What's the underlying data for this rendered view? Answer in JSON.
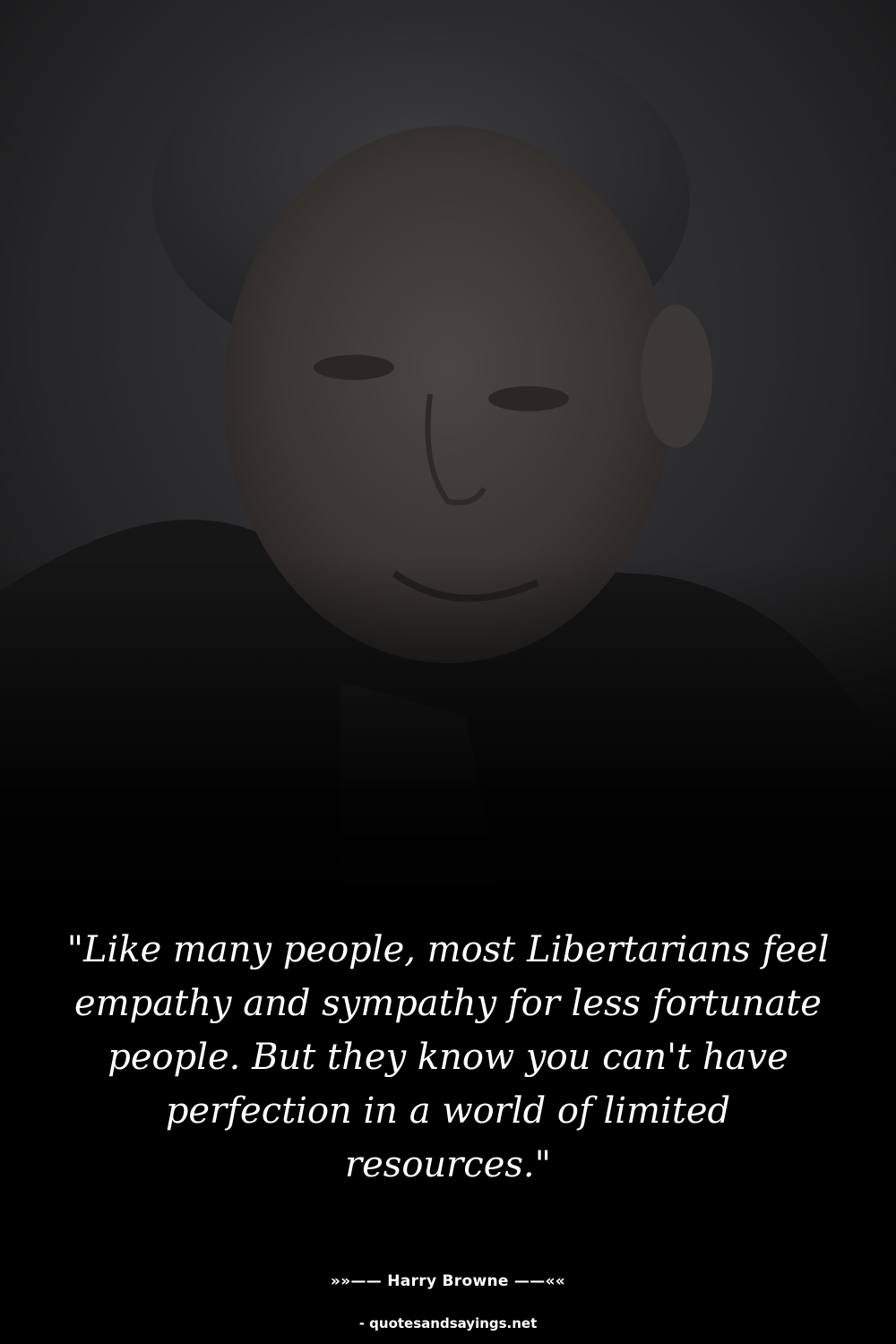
{
  "quote": {
    "text": "\"Like many people, most Libertarians feel empathy and sympathy for less fortunate people. But they know you can't have perfection in a world of limited resources.\""
  },
  "attribution": {
    "author_line": "»»—— Harry Browne ——««"
  },
  "footer": {
    "source": "- quotesandsayings.net"
  },
  "colors": {
    "background": "#000000",
    "text": "#ffffff"
  }
}
